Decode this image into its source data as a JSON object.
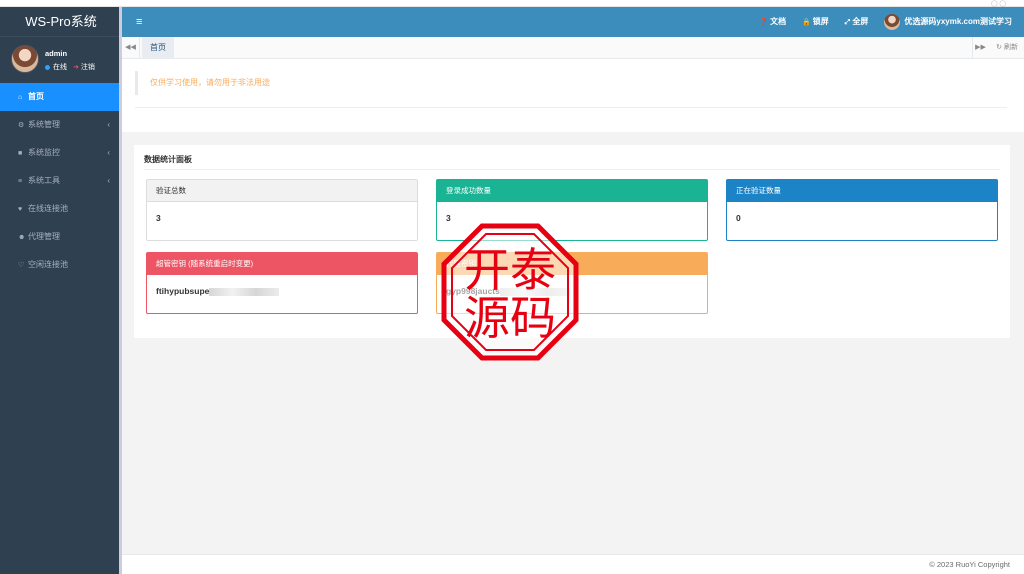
{
  "app": {
    "brand": "WS-Pro系统"
  },
  "user": {
    "name": "admin",
    "status_online": "在线",
    "status_logout": "注销"
  },
  "sidebar": {
    "items": [
      {
        "label": "首页",
        "icon": "home-icon"
      },
      {
        "label": "系统管理",
        "icon": "gear-icon"
      },
      {
        "label": "系统监控",
        "icon": "video-icon"
      },
      {
        "label": "系统工具",
        "icon": "bars-icon"
      },
      {
        "label": "在线连接池",
        "icon": "heartbeat-icon"
      },
      {
        "label": "代理管理",
        "icon": "users-icon"
      },
      {
        "label": "空闲连接池",
        "icon": "heart-icon"
      }
    ]
  },
  "header": {
    "docs": "文档",
    "lock": "锁屏",
    "fullscreen": "全屏",
    "account": "优选源码yxymk.com测试学习"
  },
  "tabs": {
    "home": "首页",
    "refresh": "刷新"
  },
  "notice": "仅供学习使用，请勿用于非法用途",
  "panel": {
    "title": "数据统计面板",
    "cards": [
      {
        "title": "验证总数",
        "value": "3"
      },
      {
        "title": "登录成功数量",
        "value": "3"
      },
      {
        "title": "正在验证数量",
        "value": "0"
      },
      {
        "title": "超管密钥 (随系统重启时变更)",
        "value": "ftihypubsupe"
      },
      {
        "title": "代理密钥",
        "value": "gyp998jaucts"
      }
    ]
  },
  "stamp": {
    "text": "开泰源码",
    "color": "#e60012"
  },
  "footer": "© 2023 RuoYi Copyright",
  "colors": {
    "sidebar": "#2f4050",
    "header": "#3c8dbc",
    "active": "#1890ff",
    "green": "#1ab394",
    "blue": "#1c84c6",
    "red": "#ed5565",
    "orange": "#f8ac59"
  }
}
